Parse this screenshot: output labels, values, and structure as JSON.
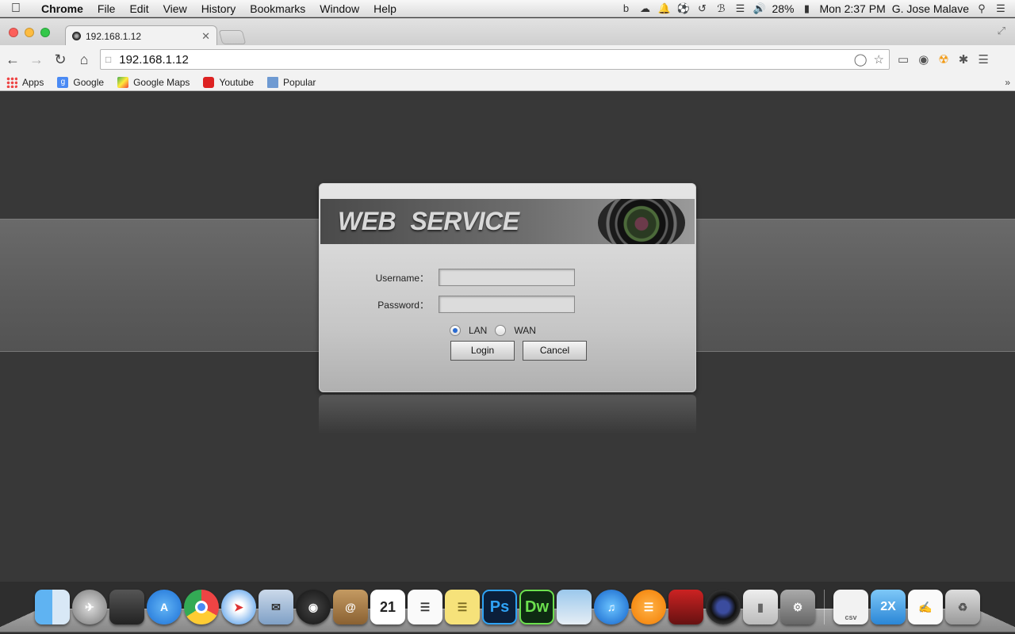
{
  "menubar": {
    "app_name": "Chrome",
    "items": [
      "File",
      "Edit",
      "View",
      "History",
      "Bookmarks",
      "Window",
      "Help"
    ],
    "battery": "28%",
    "clock": "Mon 2:37 PM",
    "user": "G. Jose Malave"
  },
  "browser": {
    "tab_title": "192.168.1.12",
    "url": "192.168.1.12",
    "bookmarks": [
      "Apps",
      "Google",
      "Google Maps",
      "Youtube",
      "Popular"
    ]
  },
  "login": {
    "title": "WEB  SERVICE",
    "username_label": "Username：",
    "password_label": "Password：",
    "username_value": "",
    "password_value": "",
    "lan_label": "LAN",
    "wan_label": "WAN",
    "selected_network": "LAN",
    "login_button": "Login",
    "cancel_button": "Cancel"
  },
  "dock": {
    "icons": [
      "finder-icon",
      "launchpad-icon",
      "photo-booth-icon",
      "app-store-icon",
      "chrome-icon",
      "safari-icon",
      "mail-icon",
      "facetime-icon",
      "contacts-icon",
      "calendar-icon",
      "reminders-icon",
      "notes-icon",
      "photoshop-icon",
      "dreamweaver-icon",
      "preview-icon",
      "itunes-icon",
      "ibooks-icon",
      "photo-slideshow-icon",
      "camera-icon",
      "switch-icon",
      "system-preferences-icon",
      "csv-file-icon",
      "2x-client-icon",
      "document-icon",
      "trash-icon"
    ],
    "calendar_day": "21",
    "ps_label": "Ps",
    "dw_label": "Dw",
    "twox_label": "2X",
    "csv_label": "csv"
  }
}
